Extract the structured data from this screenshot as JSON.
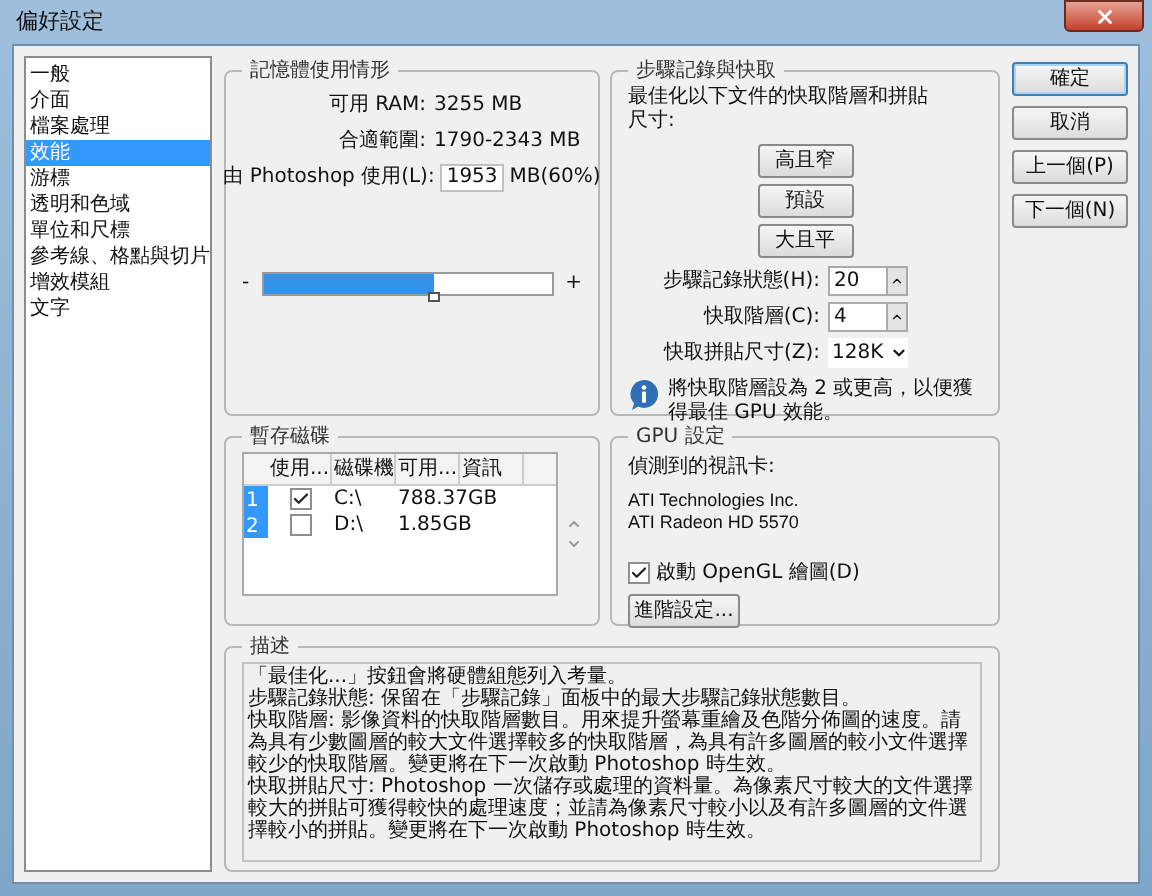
{
  "window": {
    "title": "偏好設定"
  },
  "sidebar": {
    "items": [
      {
        "label": "一般",
        "selected": false
      },
      {
        "label": "介面",
        "selected": false
      },
      {
        "label": "檔案處理",
        "selected": false
      },
      {
        "label": "效能",
        "selected": true
      },
      {
        "label": "游標",
        "selected": false
      },
      {
        "label": "透明和色域",
        "selected": false
      },
      {
        "label": "單位和尺標",
        "selected": false
      },
      {
        "label": "參考線、格點與切片",
        "selected": false
      },
      {
        "label": "增效模組",
        "selected": false
      },
      {
        "label": "文字",
        "selected": false
      }
    ]
  },
  "memory": {
    "title": "記憶體使用情形",
    "rows": [
      {
        "label": "可用 RAM:",
        "value": "3255 MB"
      },
      {
        "label": "合適範圍:",
        "value": "1790-2343 MB"
      }
    ],
    "usage": {
      "label": "由 Photoshop 使用(L):",
      "value": "1953",
      "unit": "MB(60%)"
    },
    "slider": {
      "minus": "-",
      "plus": "+",
      "level": 0.59
    }
  },
  "history": {
    "title": "步驟記錄與快取",
    "intro": "最佳化以下文件的快取階層和拼貼尺寸:",
    "presets": [
      "高且窄",
      "預設",
      "大且平"
    ],
    "fields": [
      {
        "kind": "spin",
        "label": "步驟記錄狀態(H):",
        "value": "20"
      },
      {
        "kind": "spin",
        "label": "快取階層(C):",
        "value": "4"
      },
      {
        "kind": "dropdown",
        "label": "快取拼貼尺寸(Z):",
        "value": "128K"
      }
    ],
    "note": "將快取階層設為 2 或更高，以便獲得最佳 GPU 效能。"
  },
  "buttons": [
    {
      "label": "確定",
      "default": true
    },
    {
      "label": "取消",
      "default": false
    },
    {
      "label": "上一個(P)",
      "default": false
    },
    {
      "label": "下一個(N)",
      "default": false
    }
  ],
  "scratch": {
    "title": "暫存磁碟",
    "columns": [
      "使用...",
      "磁碟機",
      "可用...",
      "資訊"
    ],
    "rows": [
      {
        "index": "1",
        "checked": true,
        "drive": "C:\\",
        "free": "788.37GB"
      },
      {
        "index": "2",
        "checked": false,
        "drive": "D:\\",
        "free": "1.85GB"
      }
    ]
  },
  "gpu": {
    "title": "GPU 設定",
    "label": "偵測到的視訊卡:",
    "card_lines": [
      "ATI Technologies Inc.",
      "ATI Radeon HD 5570"
    ],
    "opengl": {
      "label": "啟動 OpenGL 繪圖(D)",
      "checked": true
    },
    "advanced": "進階設定..."
  },
  "description": {
    "title": "描述",
    "paragraphs": [
      "「最佳化...」按鈕會將硬體組態列入考量。",
      "步驟記錄狀態: 保留在「步驟記錄」面板中的最大步驟記錄狀態數目。",
      "快取階層: 影像資料的快取階層數目。用來提升螢幕重繪及色階分佈圖的速度。請為具有少數圖層的較大文件選擇較多的快取階層，為具有許多圖層的較小文件選擇較少的快取階層。變更將在下一次啟動 Photoshop 時生效。",
      "快取拼貼尺寸: Photoshop 一次儲存或處理的資料量。為像素尺寸較大的文件選擇較大的拼貼可獲得較快的處理速度；並請為像素尺寸較小以及有許多圖層的文件選擇較小的拼貼。變更將在下一次啟動 Photoshop 時生效。"
    ]
  }
}
